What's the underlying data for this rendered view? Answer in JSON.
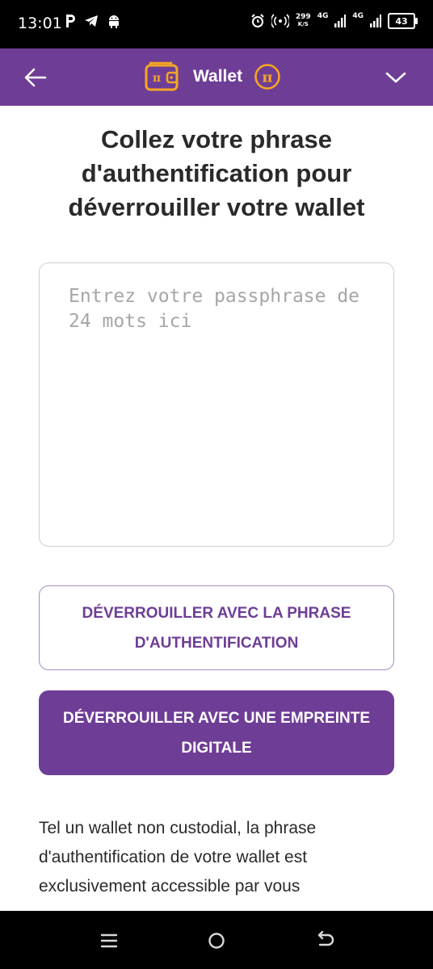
{
  "status_bar": {
    "time": "13:01",
    "speed_value": "299",
    "speed_unit": "K/S",
    "network_1": "4G",
    "network_2": "4G",
    "battery": "43"
  },
  "header": {
    "title": "Wallet"
  },
  "main": {
    "title": "Collez votre phrase d'authentification pour déverrouiller votre wallet",
    "passphrase_placeholder": "Entrez votre passphrase de 24 mots ici",
    "passphrase_value": "",
    "unlock_phrase_button": "DÉVERROUILLER AVEC LA PHRASE D'AUTHENTIFICATION",
    "unlock_fingerprint_button": "DÉVERROUILLER AVEC UNE EMPREINTE DIGITALE",
    "info_text": "Tel un wallet non custodial, la phrase d'authentification de votre wallet est exclusivement accessible par vous"
  },
  "colors": {
    "brand_purple": "#6e3d96",
    "accent_orange": "#f5a623"
  },
  "icons": {
    "back": "arrow-left-icon",
    "wallet": "wallet-icon",
    "pi": "pi-coin-icon",
    "dropdown": "chevron-down-icon"
  }
}
